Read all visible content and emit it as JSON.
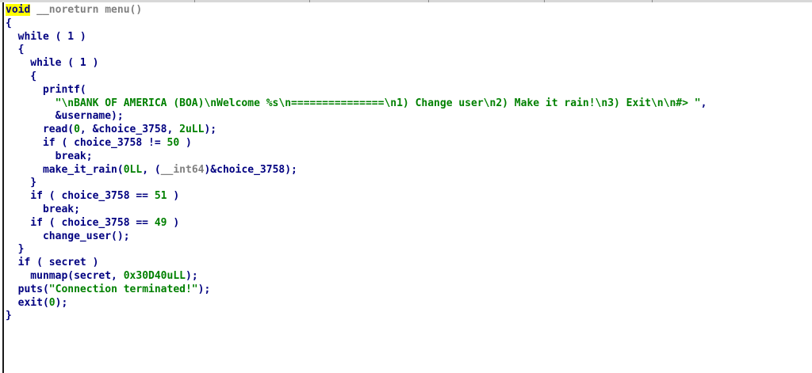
{
  "window": {
    "title": ""
  },
  "code": {
    "lines": [
      {
        "parts": [
          {
            "t": "void",
            "c": "kw-hl"
          },
          {
            "t": " ",
            "c": "punct"
          },
          {
            "t": "__noreturn menu()",
            "c": "attr"
          }
        ]
      },
      {
        "parts": [
          {
            "t": "{",
            "c": "punct"
          }
        ]
      },
      {
        "parts": [
          {
            "t": "  while ( 1 )",
            "c": "kw"
          }
        ]
      },
      {
        "parts": [
          {
            "t": "  {",
            "c": "punct"
          }
        ]
      },
      {
        "parts": [
          {
            "t": "    while ( 1 )",
            "c": "kw"
          }
        ]
      },
      {
        "parts": [
          {
            "t": "    {",
            "c": "punct"
          }
        ]
      },
      {
        "parts": [
          {
            "t": "      printf(",
            "c": "ident"
          }
        ]
      },
      {
        "parts": [
          {
            "t": "        ",
            "c": "punct"
          },
          {
            "t": "\"\\nBANK OF AMERICA (BOA)\\nWelcome %s\\n===============\\n1) Change user\\n2) Make it rain!\\n3) Exit\\n\\n#> \"",
            "c": "str"
          },
          {
            "t": ",",
            "c": "punct"
          }
        ]
      },
      {
        "parts": [
          {
            "t": "        &username);",
            "c": "ident"
          }
        ]
      },
      {
        "parts": [
          {
            "t": "      read(",
            "c": "ident"
          },
          {
            "t": "0",
            "c": "num"
          },
          {
            "t": ", &choice_3758, ",
            "c": "ident"
          },
          {
            "t": "2uLL",
            "c": "num"
          },
          {
            "t": ");",
            "c": "punct"
          }
        ]
      },
      {
        "parts": [
          {
            "t": "      if ( choice_3758 != ",
            "c": "kw"
          },
          {
            "t": "50",
            "c": "num"
          },
          {
            "t": " )",
            "c": "punct"
          }
        ]
      },
      {
        "parts": [
          {
            "t": "        break;",
            "c": "kw"
          }
        ]
      },
      {
        "parts": [
          {
            "t": "      make_it_rain(",
            "c": "ident"
          },
          {
            "t": "0LL",
            "c": "num"
          },
          {
            "t": ", (",
            "c": "punct"
          },
          {
            "t": "__int64",
            "c": "attr"
          },
          {
            "t": ")&choice_3758);",
            "c": "ident"
          }
        ]
      },
      {
        "parts": [
          {
            "t": "    }",
            "c": "punct"
          }
        ]
      },
      {
        "parts": [
          {
            "t": "    if ( choice_3758 == ",
            "c": "kw"
          },
          {
            "t": "51",
            "c": "num"
          },
          {
            "t": " )",
            "c": "punct"
          }
        ]
      },
      {
        "parts": [
          {
            "t": "      break;",
            "c": "kw"
          }
        ]
      },
      {
        "parts": [
          {
            "t": "    if ( choice_3758 == ",
            "c": "kw"
          },
          {
            "t": "49",
            "c": "num"
          },
          {
            "t": " )",
            "c": "punct"
          }
        ]
      },
      {
        "parts": [
          {
            "t": "      change_user();",
            "c": "ident"
          }
        ]
      },
      {
        "parts": [
          {
            "t": "  }",
            "c": "punct"
          }
        ]
      },
      {
        "parts": [
          {
            "t": "  if ( secret )",
            "c": "kw"
          }
        ]
      },
      {
        "parts": [
          {
            "t": "    munmap(secret, ",
            "c": "ident"
          },
          {
            "t": "0x30D40uLL",
            "c": "num"
          },
          {
            "t": ");",
            "c": "punct"
          }
        ]
      },
      {
        "parts": [
          {
            "t": "  puts(",
            "c": "ident"
          },
          {
            "t": "\"Connection terminated!\"",
            "c": "str"
          },
          {
            "t": ");",
            "c": "punct"
          }
        ]
      },
      {
        "parts": [
          {
            "t": "  exit(",
            "c": "ident"
          },
          {
            "t": "0",
            "c": "num"
          },
          {
            "t": ");",
            "c": "punct"
          }
        ]
      },
      {
        "parts": [
          {
            "t": "}",
            "c": "punct"
          }
        ]
      }
    ]
  },
  "colors": {
    "keyword_highlight": "#ffff00",
    "identifier": "#000080",
    "string_literal": "#008000",
    "number_literal": "#008000",
    "attribute_gray": "#808080"
  }
}
